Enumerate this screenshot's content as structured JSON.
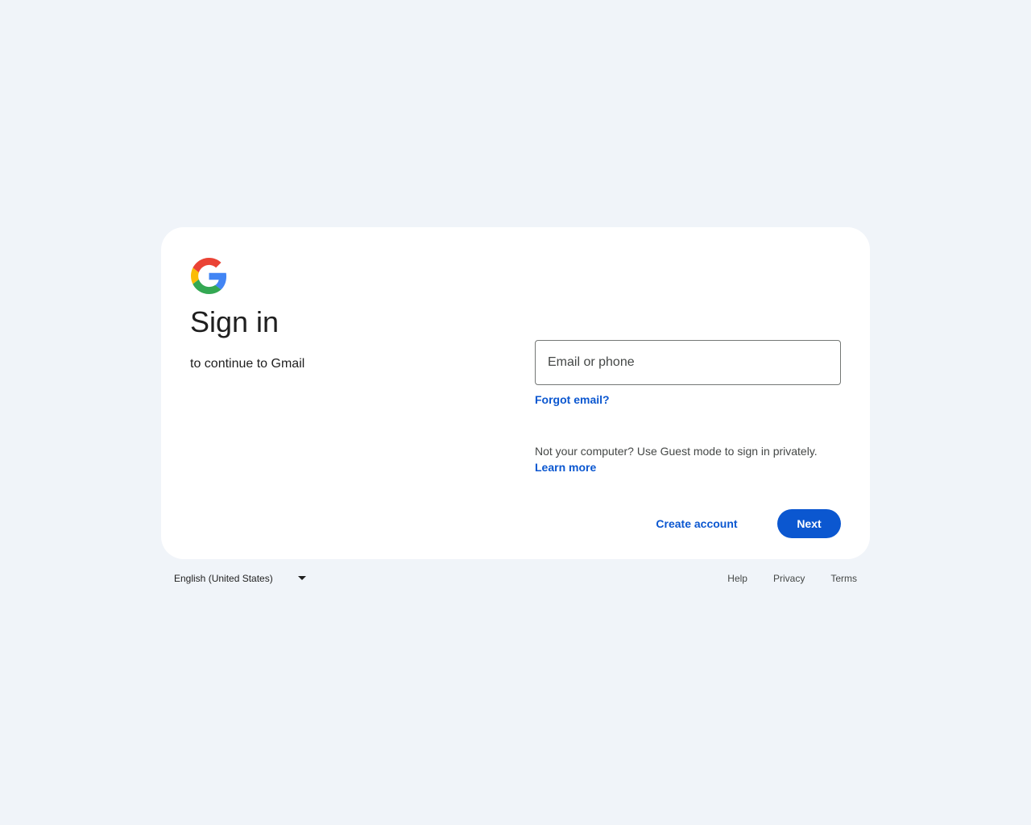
{
  "colors": {
    "background": "#f0f4f9",
    "card": "#ffffff",
    "accent": "#0b57d0",
    "text": "#1f1f1f",
    "secondary_text": "#444746"
  },
  "logo": {
    "icon": "google-g-icon"
  },
  "heading": {
    "title": "Sign in",
    "subtitle": "to continue to Gmail"
  },
  "form": {
    "email_placeholder": "Email or phone",
    "email_value": "",
    "forgot_email": "Forgot email?",
    "guest_text": "Not your computer? Use Guest mode to sign in privately.",
    "learn_more": "Learn more"
  },
  "actions": {
    "create_account": "Create account",
    "next": "Next"
  },
  "footer": {
    "language": "English (United States)",
    "language_icon": "caret-down-icon",
    "links": [
      "Help",
      "Privacy",
      "Terms"
    ]
  }
}
